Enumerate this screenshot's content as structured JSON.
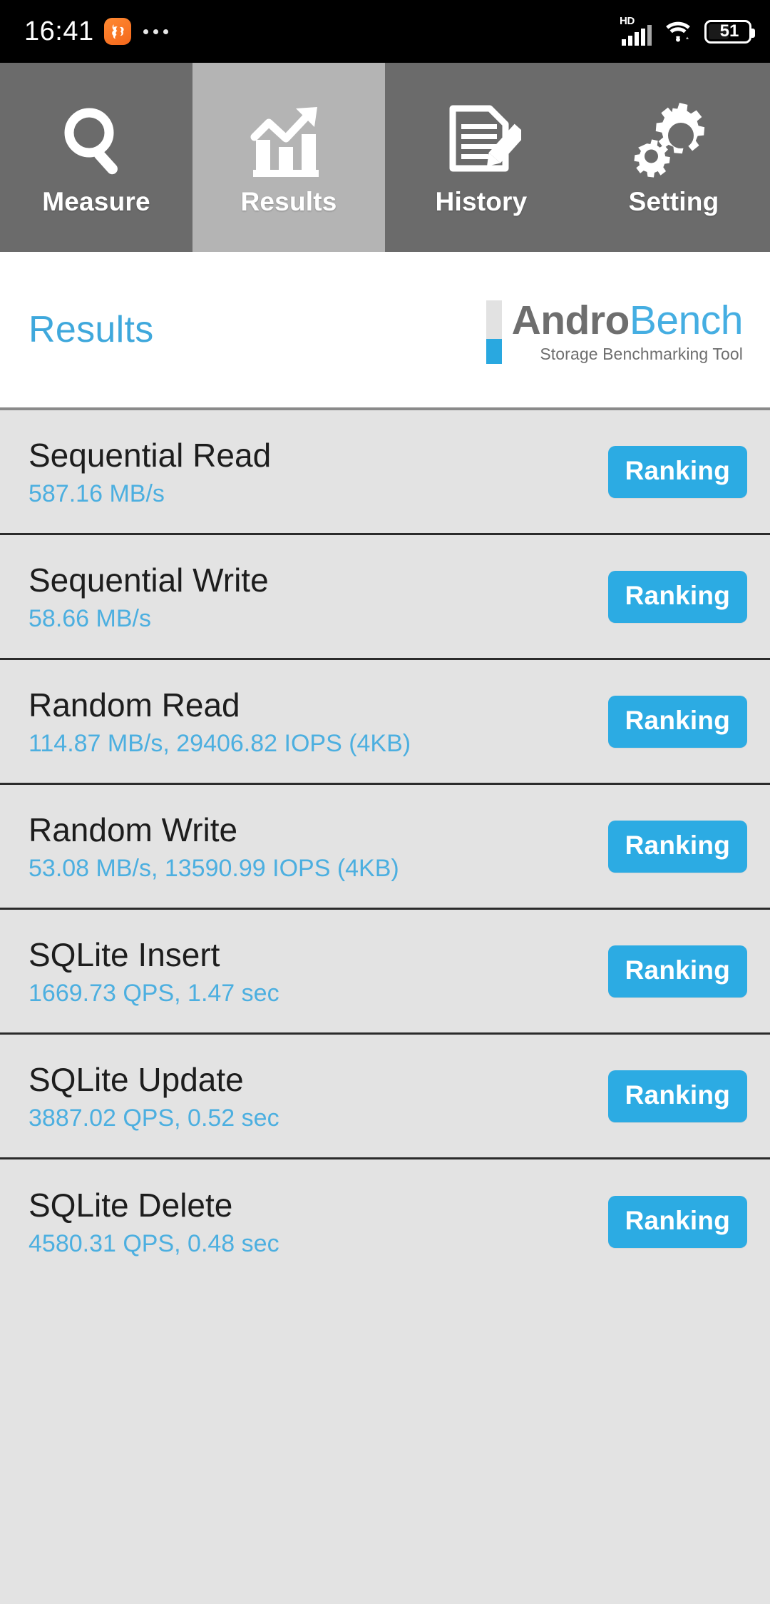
{
  "status_bar": {
    "time": "16:41",
    "app_icon": "uc-browser-icon",
    "overflow": "more-dots-icon",
    "network_type": "HD",
    "signal_icon": "signal-bars-icon",
    "wifi_icon": "wifi-icon",
    "battery_icon": "battery-icon",
    "battery_percent": "51"
  },
  "tabs": [
    {
      "label": "Measure",
      "icon": "magnifier-icon",
      "active": false
    },
    {
      "label": "Results",
      "icon": "bar-chart-icon",
      "active": true
    },
    {
      "label": "History",
      "icon": "document-pencil-icon",
      "active": false
    },
    {
      "label": "Setting",
      "icon": "gears-icon",
      "active": false
    }
  ],
  "header": {
    "title": "Results",
    "logo_primary": "Andro",
    "logo_secondary": "Bench",
    "logo_tagline": "Storage Benchmarking Tool"
  },
  "results": [
    {
      "name": "Sequential Read",
      "value": "587.16 MB/s",
      "button": "Ranking"
    },
    {
      "name": "Sequential Write",
      "value": "58.66 MB/s",
      "button": "Ranking"
    },
    {
      "name": "Random Read",
      "value": "114.87 MB/s, 29406.82 IOPS (4KB)",
      "button": "Ranking"
    },
    {
      "name": "Random Write",
      "value": "53.08 MB/s, 13590.99 IOPS (4KB)",
      "button": "Ranking"
    },
    {
      "name": "SQLite Insert",
      "value": "1669.73 QPS, 1.47 sec",
      "button": "Ranking"
    },
    {
      "name": "SQLite Update",
      "value": "3887.02 QPS, 0.52 sec",
      "button": "Ranking"
    },
    {
      "name": "SQLite Delete",
      "value": "4580.31 QPS, 0.48 sec",
      "button": "Ranking"
    }
  ],
  "colors": {
    "accent_blue": "#2CABE3",
    "value_blue": "#4CAFE0",
    "title_blue": "#3FA8DC",
    "tab_inactive": "#6B6B6B",
    "tab_active": "#B4B4B4",
    "list_bg": "#E3E3E3",
    "logo_gray": "#6E6E6E"
  }
}
